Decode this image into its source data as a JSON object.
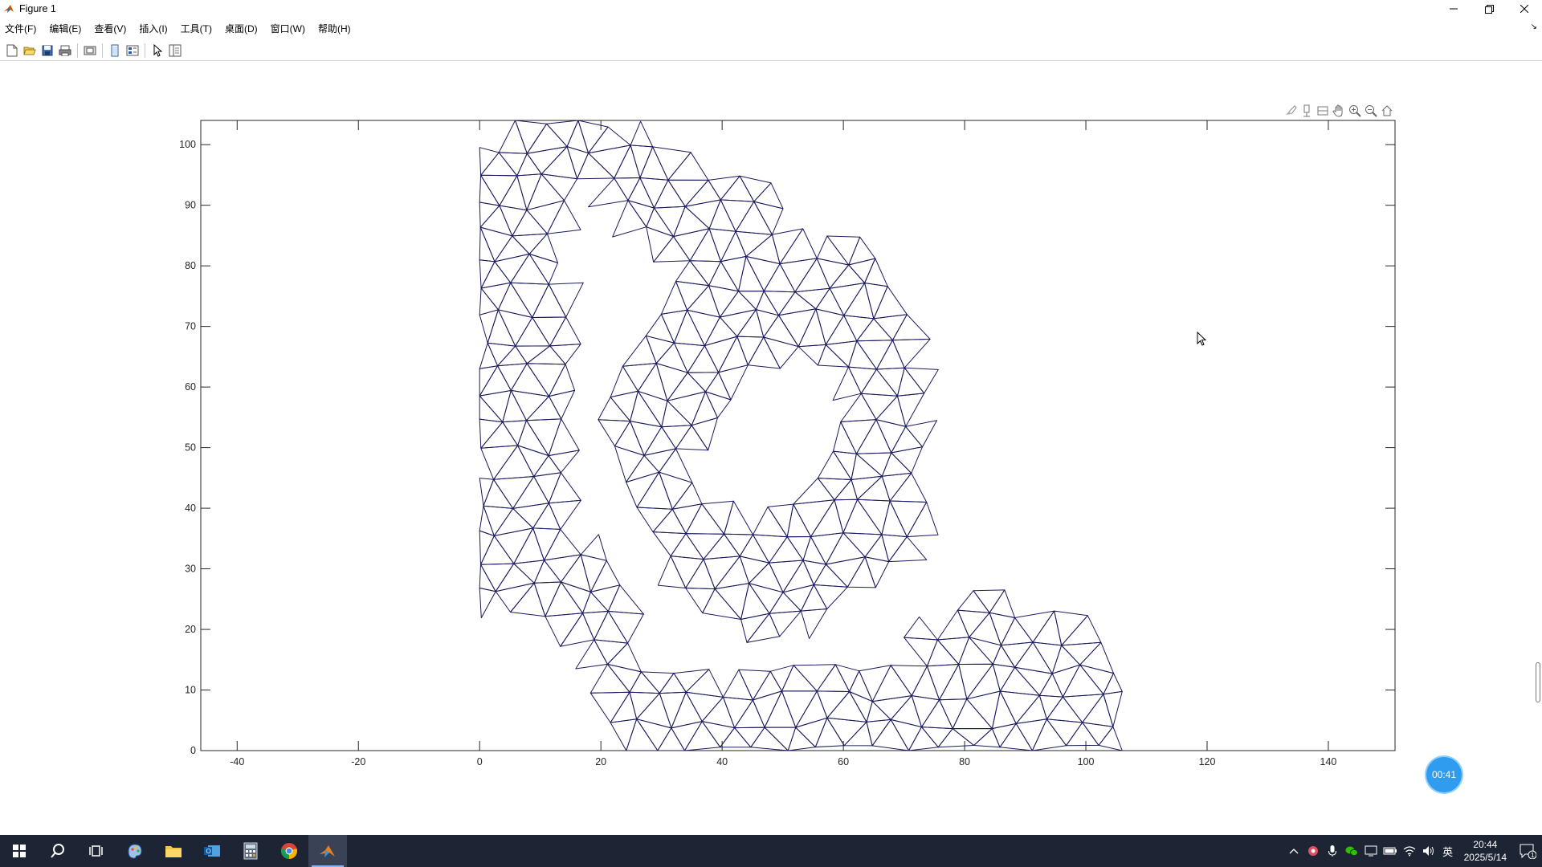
{
  "window": {
    "title": "Figure 1",
    "controls": {
      "minimize": "minimize-icon",
      "maximize": "restore-icon",
      "close": "close-icon"
    }
  },
  "menu": {
    "items": [
      "文件(F)",
      "编辑(E)",
      "查看(V)",
      "插入(I)",
      "工具(T)",
      "桌面(D)",
      "窗口(W)",
      "帮助(H)"
    ]
  },
  "toolbar": {
    "buttons": [
      "new-figure-icon",
      "open-icon",
      "save-icon",
      "print-icon",
      "print-preview-icon",
      "link-plot-icon",
      "property-inspector-icon",
      "edit-plot-icon",
      "panel-icon"
    ]
  },
  "axes_toolbar": [
    "brush-icon",
    "data-tip-icon",
    "rotate-icon",
    "pan-icon",
    "zoom-in-icon",
    "zoom-out-icon",
    "home-icon"
  ],
  "chart_data": {
    "type": "mesh",
    "title": "",
    "xlabel": "",
    "ylabel": "",
    "xlim": [
      -46,
      151
    ],
    "ylim": [
      0,
      104
    ],
    "xticks": [
      -40,
      -20,
      0,
      20,
      40,
      60,
      80,
      100,
      120,
      140
    ],
    "yticks": [
      0,
      10,
      20,
      30,
      40,
      50,
      60,
      70,
      80,
      90,
      100
    ],
    "grid": false,
    "line_color": "#1a1a5e",
    "regions": {
      "left_strip": [
        [
          0,
          100
        ],
        [
          9,
          98
        ],
        [
          15,
          100
        ],
        [
          14.5,
          104
        ],
        [
          21,
          102
        ],
        [
          28,
          101
        ],
        [
          30,
          97
        ],
        [
          34,
          99
        ],
        [
          41,
          95
        ],
        [
          48,
          92
        ],
        [
          49,
          85
        ],
        [
          54,
          83
        ],
        [
          60,
          84
        ],
        [
          65,
          81
        ],
        [
          68,
          77
        ],
        [
          72,
          73
        ],
        [
          71,
          64
        ],
        [
          68,
          60
        ],
        [
          70,
          56
        ],
        [
          72,
          50
        ],
        [
          77,
          44
        ],
        [
          79,
          37
        ],
        [
          77,
          32
        ],
        [
          73,
          28
        ],
        [
          62,
          24
        ],
        [
          55,
          21
        ],
        [
          52,
          18
        ],
        [
          47,
          21
        ],
        [
          43,
          28
        ],
        [
          45,
          33
        ],
        [
          43,
          38
        ],
        [
          39,
          45
        ],
        [
          38,
          50
        ],
        [
          39,
          55
        ],
        [
          37,
          60
        ],
        [
          38,
          67
        ],
        [
          34,
          70
        ],
        [
          29,
          72
        ],
        [
          28,
          77
        ],
        [
          24,
          79
        ],
        [
          21,
          83
        ],
        [
          17,
          89
        ],
        [
          16,
          96
        ],
        [
          10,
          91
        ],
        [
          4,
          91
        ],
        [
          0,
          89
        ],
        [
          0,
          83
        ],
        [
          9,
          78
        ],
        [
          15,
          75
        ],
        [
          14,
          68
        ],
        [
          16,
          64
        ],
        [
          14,
          53
        ],
        [
          11,
          50
        ],
        [
          11,
          43
        ],
        [
          13,
          39
        ],
        [
          10,
          33
        ],
        [
          4,
          30
        ],
        [
          0,
          29
        ],
        [
          0,
          24
        ]
      ],
      "hole": [
        [
          50,
          66
        ],
        [
          56,
          65
        ],
        [
          60,
          63
        ],
        [
          61,
          58
        ],
        [
          60,
          52
        ],
        [
          58,
          45
        ],
        [
          53,
          41
        ],
        [
          47,
          38
        ],
        [
          40,
          39
        ],
        [
          36,
          43
        ],
        [
          35,
          48
        ],
        [
          38,
          53
        ],
        [
          42,
          59
        ]
      ],
      "bottom_band": [
        [
          22,
          0
        ],
        [
          105,
          0
        ],
        [
          105,
          13
        ],
        [
          104,
          18
        ],
        [
          97,
          24
        ],
        [
          94,
          20
        ],
        [
          89,
          22
        ],
        [
          87,
          26
        ],
        [
          80,
          19
        ],
        [
          73,
          22
        ],
        [
          71,
          13
        ],
        [
          68,
          12
        ],
        [
          63,
          15
        ],
        [
          60,
          14
        ],
        [
          52,
          12
        ],
        [
          46,
          14
        ],
        [
          42,
          12
        ],
        [
          37,
          11
        ],
        [
          33,
          13
        ],
        [
          29,
          12
        ],
        [
          25,
          17
        ],
        [
          24,
          11
        ]
      ],
      "right_tower": [
        [
          78,
          0
        ],
        [
          88,
          0
        ],
        [
          88,
          29
        ],
        [
          83,
          27
        ],
        [
          78,
          23
        ],
        [
          78,
          17
        ]
      ]
    }
  },
  "badge": {
    "timer": "00:41"
  },
  "taskbar": {
    "apps": [
      "windows-start-icon",
      "search-icon",
      "task-view-icon",
      "paint-icon",
      "file-explorer-icon",
      "outlook-icon",
      "calculator-icon",
      "chrome-icon",
      "matlab-icon"
    ],
    "tray": [
      "chevron-up-icon",
      "network-app-icon",
      "microphone-icon",
      "wechat-icon",
      "display-icon",
      "battery-icon",
      "wifi-icon",
      "volume-icon"
    ],
    "ime": "英",
    "time": "20:44",
    "date": "2025/5/14",
    "notifications": "1"
  }
}
